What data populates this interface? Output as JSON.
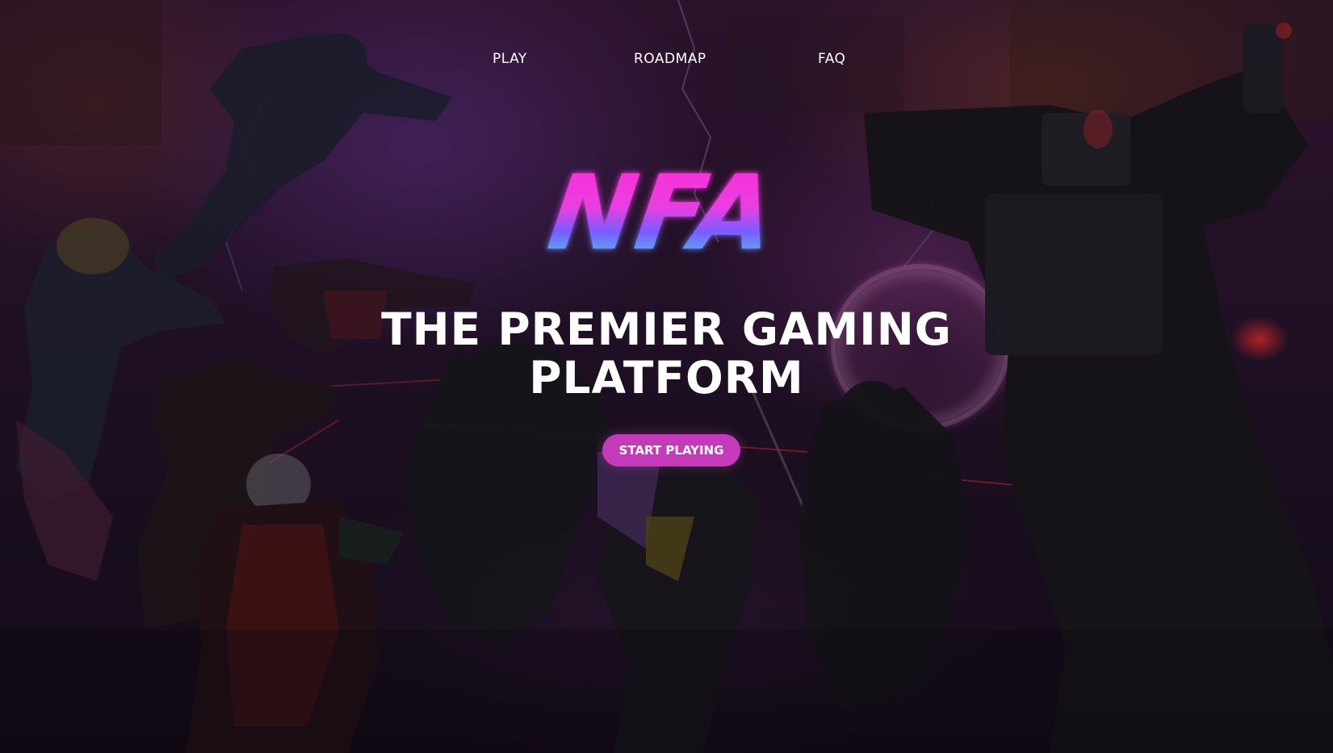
{
  "nav": {
    "items": [
      {
        "label": "PLAY"
      },
      {
        "label": "ROADMAP"
      },
      {
        "label": "FAQ"
      }
    ]
  },
  "logo": {
    "text": "NFA",
    "colors": [
      "#ff2bd6",
      "#7a5cff",
      "#3ff3e6"
    ]
  },
  "hero": {
    "headline_line1": "THE PREMIER GAMING",
    "headline_line2": "PLATFORM",
    "cta_label": "START PLAYING"
  },
  "colors": {
    "accent": "#c53ab8",
    "text": "#ffffff",
    "laser": "#ff2a3a"
  }
}
